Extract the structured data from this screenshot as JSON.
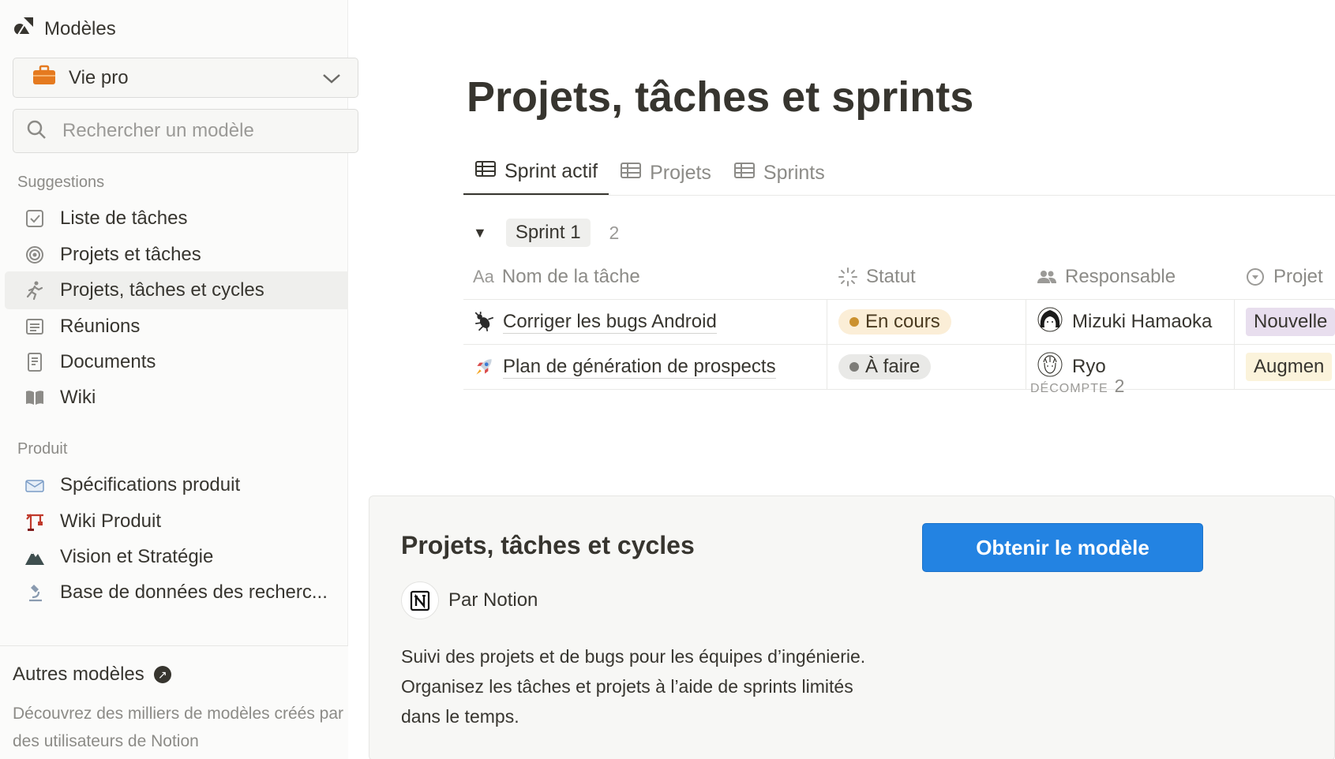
{
  "sidebar": {
    "header_title": "Modèles",
    "dropdown_value": "Vie pro",
    "search_placeholder": "Rechercher un modèle",
    "sections": [
      {
        "label": "Suggestions",
        "items": [
          {
            "label": "Liste de tâches",
            "icon": "checkbox-icon"
          },
          {
            "label": "Projets et tâches",
            "icon": "target-icon"
          },
          {
            "label": "Projets, tâches et cycles",
            "icon": "runner-icon",
            "active": true
          },
          {
            "label": "Réunions",
            "icon": "meeting-list-icon"
          },
          {
            "label": "Documents",
            "icon": "document-icon"
          },
          {
            "label": "Wiki",
            "icon": "book-icon"
          }
        ]
      },
      {
        "label": "Produit",
        "items": [
          {
            "label": "Spécifications produit",
            "icon": "envelope-icon"
          },
          {
            "label": "Wiki Produit",
            "icon": "crane-icon"
          },
          {
            "label": "Vision et Stratégie",
            "icon": "mountain-icon"
          },
          {
            "label": "Base de données des recherc...",
            "icon": "microscope-icon"
          }
        ]
      }
    ],
    "footer": {
      "title": "Autres modèles",
      "description": "Découvrez des milliers de modèles créés par des utilisateurs de Notion"
    }
  },
  "main": {
    "page_title": "Projets, tâches et sprints",
    "tabs": [
      {
        "label": "Sprint actif",
        "active": true
      },
      {
        "label": "Projets"
      },
      {
        "label": "Sprints"
      }
    ],
    "group": {
      "label": "Sprint 1",
      "count": "2"
    },
    "table": {
      "columns": [
        "Nom de la tâche",
        "Statut",
        "Responsable",
        "Projet"
      ],
      "name_prefix": "Aa",
      "rows": [
        {
          "emoji": "🐜",
          "name": "Corriger les bugs Android",
          "status": "En cours",
          "status_type": "inprogress",
          "assignee": "Mizuki Hamaoka",
          "project": "Nouvelle"
        },
        {
          "emoji": "🚀",
          "name": "Plan de génération de prospects",
          "status": "À faire",
          "status_type": "todo",
          "assignee": "Ryo",
          "project": "Augmen"
        }
      ]
    },
    "count_label": "DÉCOMPTE",
    "count_value": "2"
  },
  "card": {
    "title": "Projets, tâches et cycles",
    "author": "Par Notion",
    "description": "Suivi des projets et de bugs pour les équipes d’ingénierie. Organisez les tâches et projets à l’aide de sprints limités dans le temps.",
    "cta_label": "Obtenir le modèle"
  },
  "colors": {
    "accent": "#2383e2",
    "status_in_progress": "#cb912f",
    "status_todo": "#7d7c78",
    "sidebar_bg": "#fbfbfa"
  }
}
